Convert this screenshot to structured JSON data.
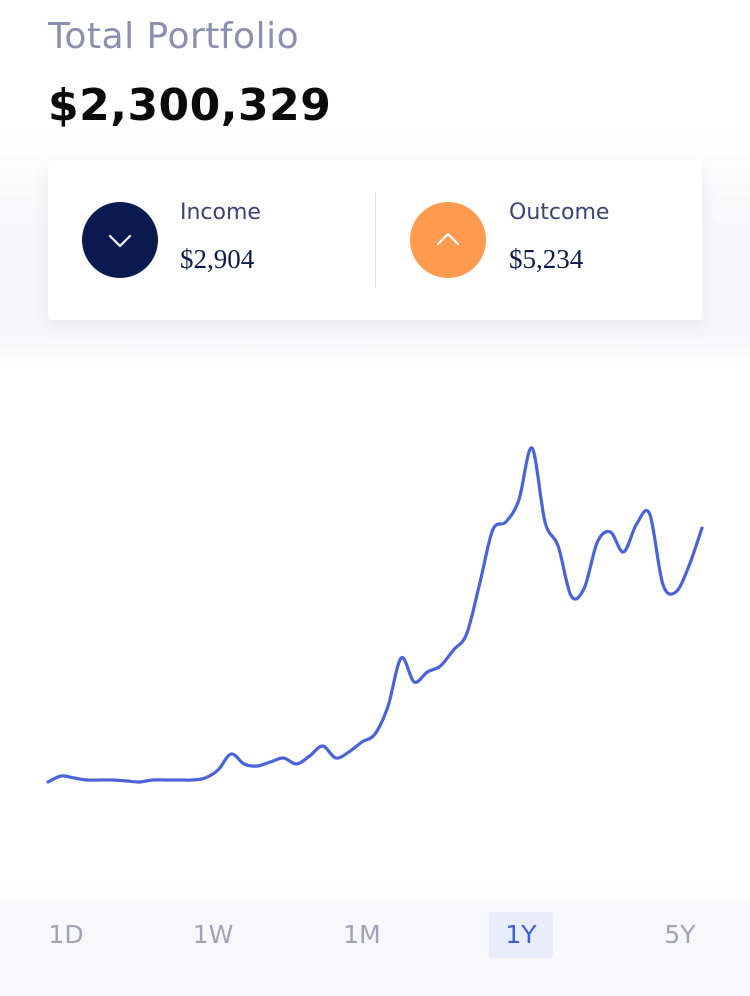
{
  "portfolio": {
    "title": "Total Portfolio",
    "total": "$2,300,329"
  },
  "stats": {
    "income": {
      "label": "Income",
      "value": "$2,904",
      "icon": "chevron-down-icon",
      "color": "#0a1a4f"
    },
    "outcome": {
      "label": "Outcome",
      "value": "$5,234",
      "icon": "chevron-up-icon",
      "color": "#ff9a4f"
    }
  },
  "chart_data": {
    "type": "line",
    "series": [
      {
        "color": "#4a63d8",
        "values": [
          4,
          7,
          6,
          5,
          5,
          5,
          4.5,
          4,
          5,
          5,
          5,
          5,
          6,
          10,
          18,
          13,
          12,
          14,
          16,
          13,
          17,
          22,
          16,
          19,
          24,
          28,
          42,
          66,
          54,
          59,
          62,
          70,
          78,
          103,
          130,
          134,
          145,
          171,
          134,
          122,
          97,
          101,
          124,
          129,
          119,
          133,
          138,
          103,
          99,
          112,
          131
        ]
      }
    ],
    "grid": false,
    "axes": false
  },
  "ranges": {
    "items": [
      {
        "label": "1D",
        "active": false
      },
      {
        "label": "1W",
        "active": false
      },
      {
        "label": "1M",
        "active": false
      },
      {
        "label": "1Y",
        "active": true
      },
      {
        "label": "5Y",
        "active": false
      }
    ]
  }
}
